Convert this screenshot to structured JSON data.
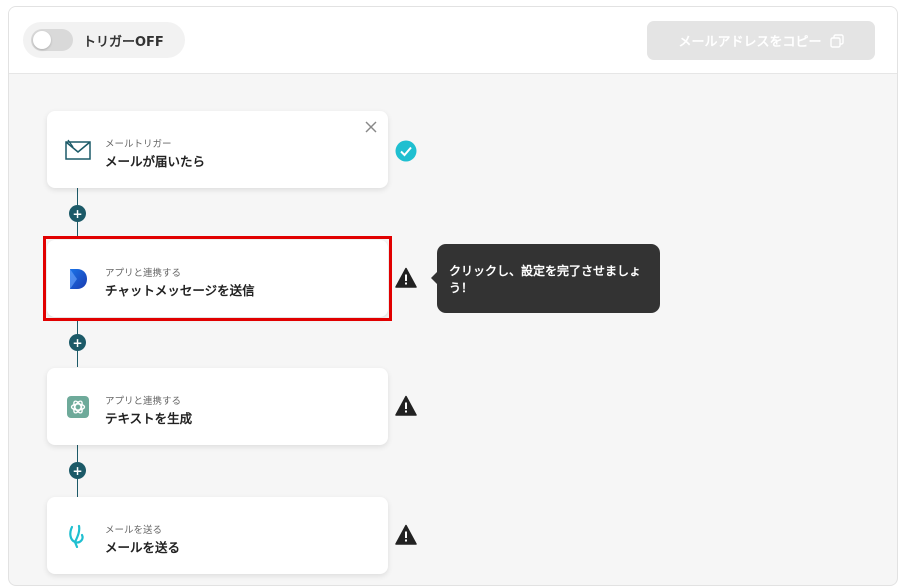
{
  "topbar": {
    "trigger_label": "トリガーOFF",
    "trigger_on": false,
    "copy_button_label": "メールアドレスをコピー"
  },
  "steps": [
    {
      "sub": "メールトリガー",
      "title": "メールが届いたら",
      "icon": "mail-icon",
      "status": "done"
    },
    {
      "sub": "アプリと連携する",
      "title": "チャットメッセージを送信",
      "icon": "chat-app-icon",
      "status": "warning"
    },
    {
      "sub": "アプリと連携する",
      "title": "テキストを生成",
      "icon": "ai-icon",
      "status": "warning"
    },
    {
      "sub": "メールを送る",
      "title": "メールを送る",
      "icon": "send-mail-icon",
      "status": "warning"
    }
  ],
  "tooltip": {
    "text": "クリックし、設定を完了させましょう！"
  },
  "colors": {
    "accent": "#1c5a68",
    "success": "#1fbfd0",
    "highlight": "#e10000",
    "tooltip_bg": "#333333"
  }
}
